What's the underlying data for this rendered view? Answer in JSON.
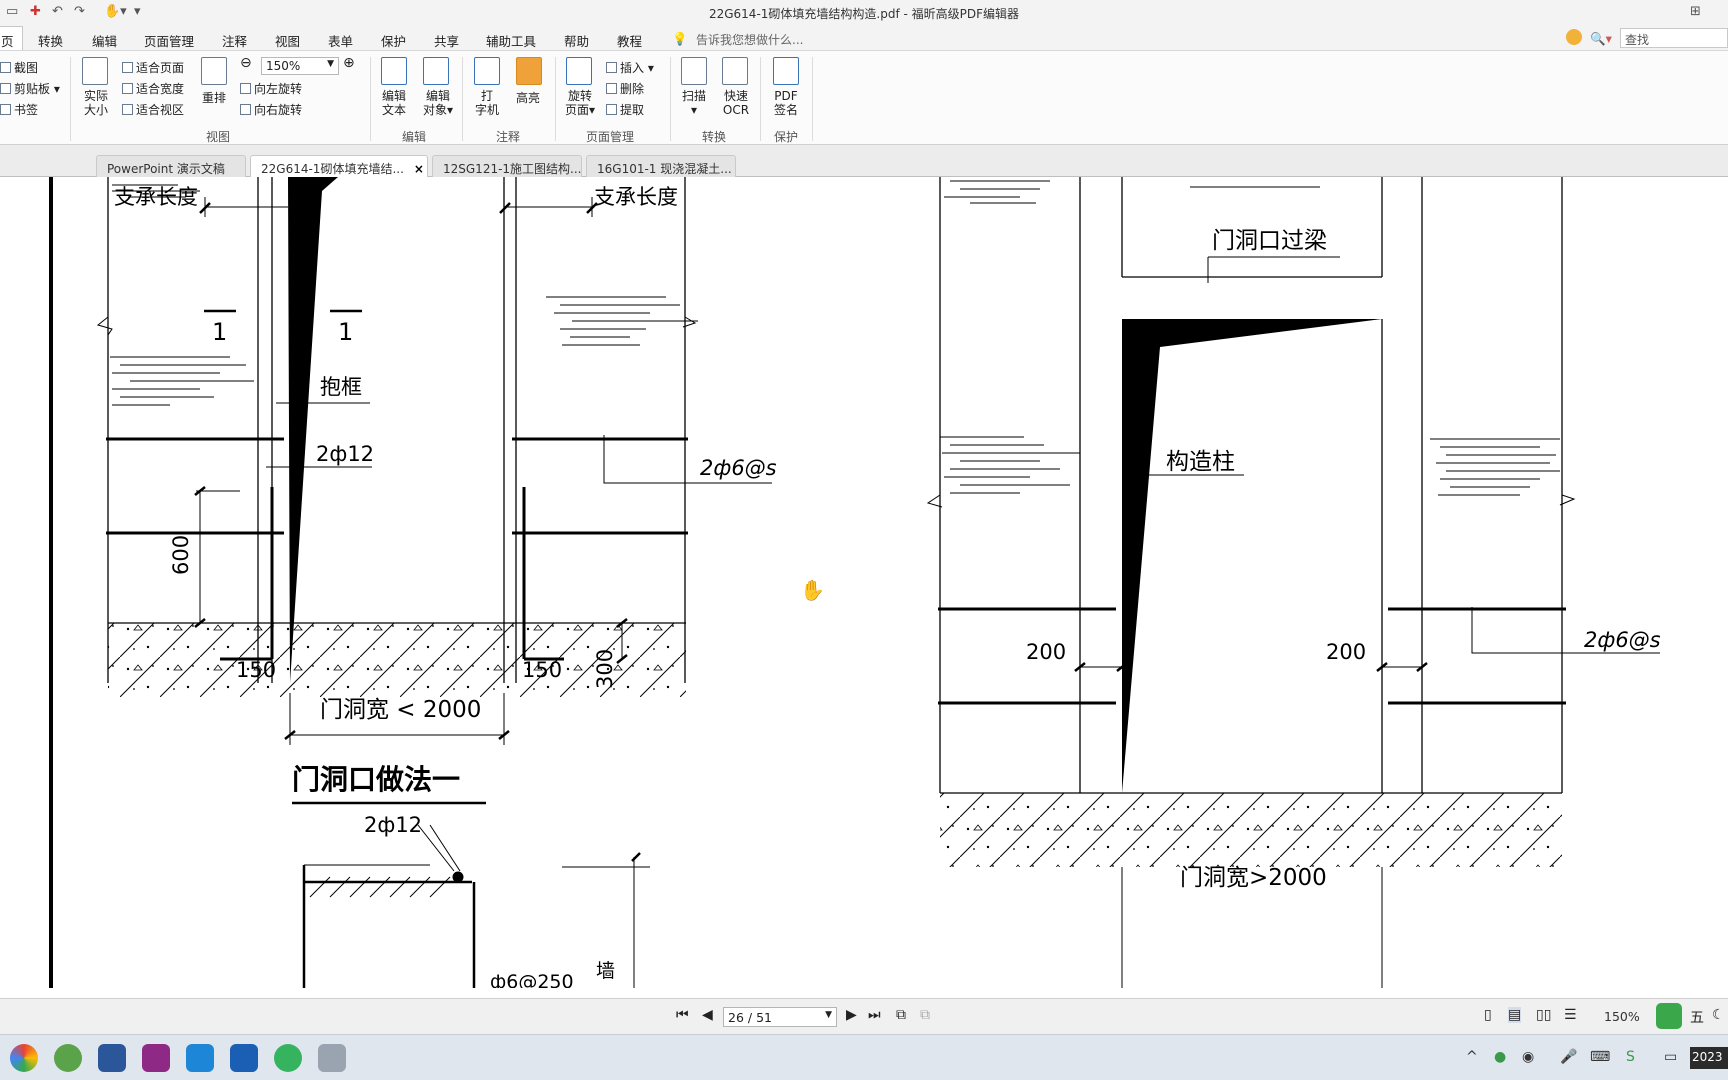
{
  "window": {
    "title": "22G614-1砌体填充墙结构构造.pdf - 福昕高级PDF编辑器"
  },
  "menu": {
    "items": [
      "页",
      "转换",
      "编辑",
      "页面管理",
      "注释",
      "视图",
      "表单",
      "保护",
      "共享",
      "辅助工具",
      "帮助",
      "教程"
    ],
    "tell_me": "告诉我您想做什么...",
    "search_placeholder": "查找"
  },
  "ribbon": {
    "clipboard": {
      "screenshot": "截图",
      "clipboard": "剪贴板",
      "bookmark": "书签"
    },
    "view": {
      "actual_size_1": "实际",
      "actual_size_2": "大小",
      "fit_page": "适合页面",
      "fit_width": "适合宽度",
      "fit_visible": "适合视区",
      "reflow": "重排",
      "zoom": "150%",
      "rotate_left": "向左旋转",
      "rotate_right": "向右旋转",
      "group": "视图"
    },
    "edit": {
      "edit_text_1": "编辑",
      "edit_text_2": "文本",
      "edit_object_1": "编辑",
      "edit_object_2": "对象",
      "group": "编辑"
    },
    "comment": {
      "typewriter_1": "打",
      "typewriter_2": "字机",
      "highlight": "高亮",
      "group": "注释"
    },
    "page_mgmt": {
      "rotate_1": "旋转",
      "rotate_2": "页面",
      "insert": "插入",
      "delete": "删除",
      "extract": "提取",
      "group": "页面管理"
    },
    "convert": {
      "scan": "扫描",
      "ocr_1": "快速",
      "ocr_2": "OCR",
      "group": "转换"
    },
    "protect": {
      "sign_1": "PDF",
      "sign_2": "签名",
      "group": "保护"
    }
  },
  "tabs": [
    {
      "label": "PowerPoint 演示文稿"
    },
    {
      "label": "22G614-1砌体填充墙结...",
      "close": "×"
    },
    {
      "label": "12SG121-1施工图结构..."
    },
    {
      "label": "16G101-1 现浇混凝土..."
    }
  ],
  "drawing": {
    "left": {
      "support_len_l": "支承长度",
      "support_len_r": "支承长度",
      "sec_1a": "1",
      "sec_1b": "1",
      "frame": "抱框",
      "rebar_2phi12": "2ф12",
      "rebar_2phi6": "2ф6@s",
      "dim_600": "600",
      "dim_150a": "150",
      "dim_150b": "150",
      "dim_300": "300",
      "door_width": "门洞宽 < 2000",
      "method_title": "门洞口做法一",
      "rebar_2phi12_b": "2ф12",
      "rebar_phi6_250": "ф6@250",
      "frag": "墙"
    },
    "right": {
      "lintel": "门洞口过梁",
      "column": "构造柱",
      "dim_200a": "200",
      "dim_200b": "200",
      "rebar_2phi6": "2ф6@s",
      "door_width": "门洞宽>2000"
    }
  },
  "status": {
    "page": "26 / 51",
    "zoom": "150%"
  },
  "taskbar": {
    "clock": "2023"
  }
}
